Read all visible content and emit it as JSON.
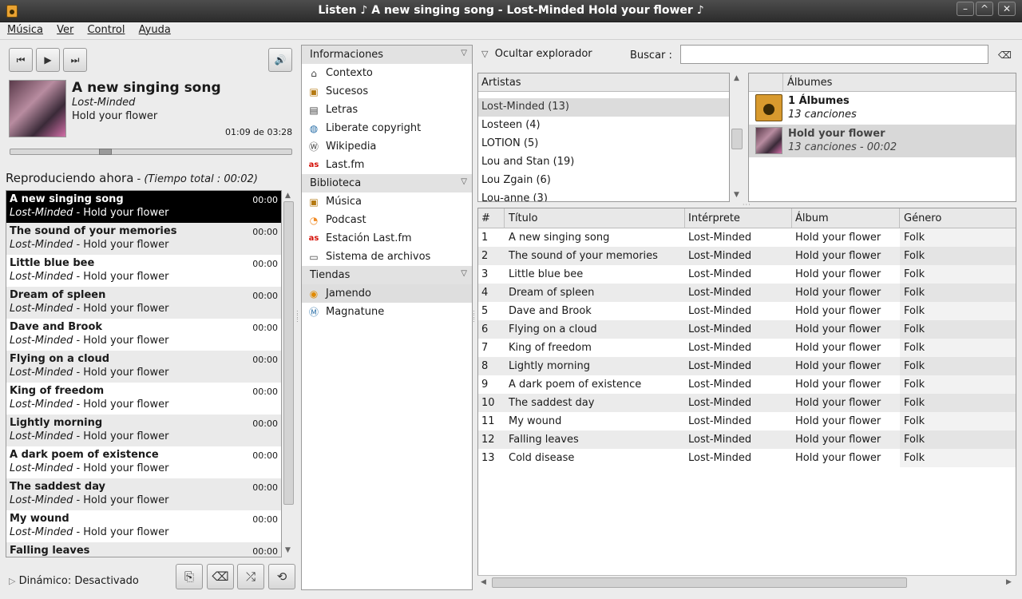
{
  "window": {
    "title": "Listen  ♪ A new singing song  - Lost-Minded Hold your flower ♪"
  },
  "menu": [
    "Música",
    "Ver",
    "Control",
    "Ayuda"
  ],
  "player": {
    "title": "A new singing song",
    "artist": "Lost-Minded",
    "album": "Hold your flower",
    "time": "01:09 de 03:28",
    "progress": 0.33
  },
  "now_playing": {
    "heading": "Reproduciendo ahora",
    "total": " - (Tiempo total : 00:02)",
    "rows": [
      {
        "title": "A new singing song",
        "artist": "Lost-Minded",
        "album": " - Hold your flower",
        "dur": "00:00"
      },
      {
        "title": "The sound of your memories",
        "artist": "Lost-Minded",
        "album": " - Hold your flower",
        "dur": "00:00"
      },
      {
        "title": "Little blue bee",
        "artist": "Lost-Minded",
        "album": " - Hold your flower",
        "dur": "00:00"
      },
      {
        "title": "Dream of spleen",
        "artist": "Lost-Minded",
        "album": " - Hold your flower",
        "dur": "00:00"
      },
      {
        "title": "Dave and Brook",
        "artist": "Lost-Minded",
        "album": " - Hold your flower",
        "dur": "00:00"
      },
      {
        "title": "Flying on a cloud",
        "artist": "Lost-Minded",
        "album": " - Hold your flower",
        "dur": "00:00"
      },
      {
        "title": "King of freedom",
        "artist": "Lost-Minded",
        "album": " - Hold your flower",
        "dur": "00:00"
      },
      {
        "title": "Lightly morning",
        "artist": "Lost-Minded",
        "album": " - Hold your flower",
        "dur": "00:00"
      },
      {
        "title": "A dark poem of existence",
        "artist": "Lost-Minded",
        "album": " - Hold your flower",
        "dur": "00:00"
      },
      {
        "title": "The saddest day",
        "artist": "Lost-Minded",
        "album": " - Hold your flower",
        "dur": "00:00"
      },
      {
        "title": "My wound",
        "artist": "Lost-Minded",
        "album": " - Hold your flower",
        "dur": "00:00"
      },
      {
        "title": "Falling leaves",
        "artist": "",
        "album": "",
        "dur": "00:00"
      }
    ],
    "dynamic": "Dinámico: Desactivado"
  },
  "sidebar": {
    "sections": [
      {
        "label": "Informaciones",
        "items": [
          {
            "label": "Contexto",
            "icon": "home-icon"
          },
          {
            "label": "Sucesos",
            "icon": "speaker-icon"
          },
          {
            "label": "Letras",
            "icon": "document-icon"
          },
          {
            "label": "Liberate copyright",
            "icon": "globe-icon"
          },
          {
            "label": "Wikipedia",
            "icon": "wikipedia-icon"
          },
          {
            "label": "Last.fm",
            "icon": "lastfm-icon"
          }
        ]
      },
      {
        "label": "Biblioteca",
        "items": [
          {
            "label": "Música",
            "icon": "speaker-icon"
          },
          {
            "label": "Podcast",
            "icon": "rss-icon"
          },
          {
            "label": "Estación Last.fm",
            "icon": "lastfm-icon"
          },
          {
            "label": "Sistema de archivos",
            "icon": "drive-icon"
          }
        ]
      },
      {
        "label": "Tiendas",
        "items": [
          {
            "label": "Jamendo",
            "icon": "jamendo-icon"
          },
          {
            "label": "Magnatune",
            "icon": "magnatune-icon"
          }
        ]
      }
    ]
  },
  "explorer": {
    "toggle": "Ocultar explorador",
    "search_label": "Buscar :",
    "search_value": "",
    "artists_header": "Artistas",
    "artists": [
      "Lost-Minded (13)",
      "Losteen (4)",
      "LOTION (5)",
      "Lou and Stan (19)",
      "Lou Zgain (6)",
      "Lou-anne (3)"
    ],
    "albums_header": "Álbumes",
    "albums": [
      {
        "title": "1 Álbumes",
        "sub": "13 canciones"
      },
      {
        "title": "Hold your flower",
        "sub": "13 canciones - 00:02"
      }
    ]
  },
  "tracks": {
    "headers": [
      "#",
      "Título",
      "Intérprete",
      "Álbum",
      "Género"
    ],
    "rows": [
      [
        "1",
        "A new singing song",
        "Lost-Minded",
        "Hold your flower",
        "Folk"
      ],
      [
        "2",
        "The sound of your memories",
        "Lost-Minded",
        "Hold your flower",
        "Folk"
      ],
      [
        "3",
        "Little blue bee",
        "Lost-Minded",
        "Hold your flower",
        "Folk"
      ],
      [
        "4",
        "Dream of spleen",
        "Lost-Minded",
        "Hold your flower",
        "Folk"
      ],
      [
        "5",
        "Dave and Brook",
        "Lost-Minded",
        "Hold your flower",
        "Folk"
      ],
      [
        "6",
        "Flying on a cloud",
        "Lost-Minded",
        "Hold your flower",
        "Folk"
      ],
      [
        "7",
        "King of freedom",
        "Lost-Minded",
        "Hold your flower",
        "Folk"
      ],
      [
        "8",
        "Lightly morning",
        "Lost-Minded",
        "Hold your flower",
        "Folk"
      ],
      [
        "9",
        "A dark poem of existence",
        "Lost-Minded",
        "Hold your flower",
        "Folk"
      ],
      [
        "10",
        "The saddest day",
        "Lost-Minded",
        "Hold your flower",
        "Folk"
      ],
      [
        "11",
        "My wound",
        "Lost-Minded",
        "Hold your flower",
        "Folk"
      ],
      [
        "12",
        "Falling leaves",
        "Lost-Minded",
        "Hold your flower",
        "Folk"
      ],
      [
        "13",
        "Cold disease",
        "Lost-Minded",
        "Hold your flower",
        "Folk"
      ]
    ]
  }
}
